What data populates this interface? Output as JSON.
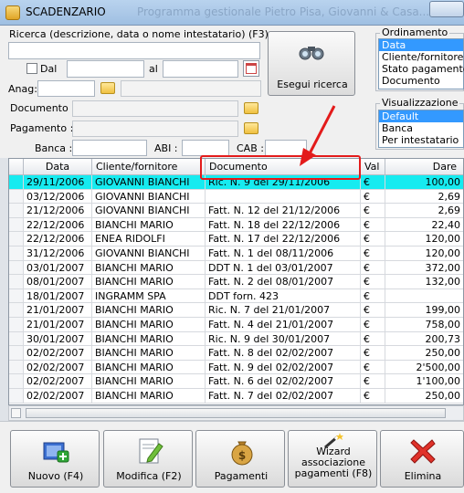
{
  "window": {
    "title": "SCADENZARIO",
    "background_title": "Programma gestionale Pietro Pisa, Giovanni & Casa..."
  },
  "search": {
    "label": "Ricerca (descrizione, data o nome intestatario) (F3)",
    "value": "",
    "dal_label": "Dal",
    "al_label": "al",
    "dal_value": "",
    "al_value": "",
    "anag_label": "Anag:",
    "documento_label": "Documento :",
    "pagamento_label": "Pagamento :",
    "banca_label": "Banca :",
    "abi_label": "ABI :",
    "cab_label": "CAB :",
    "search_button": "Esegui ricerca"
  },
  "ordinamento": {
    "title": "Ordinamento",
    "options": [
      "Data",
      "Cliente/fornitore",
      "Stato pagamento",
      "Documento"
    ],
    "selected": "Data"
  },
  "visualizzazione": {
    "title": "Visualizzazione",
    "options": [
      "Default",
      "Banca",
      "Per intestatario"
    ],
    "selected": "Default"
  },
  "table": {
    "columns": [
      "Data",
      "Cliente/fornitore",
      "Documento",
      "Val",
      "Dare"
    ],
    "rows": [
      [
        "29/11/2006",
        "GIOVANNI BIANCHI",
        "Ric. N. 9 del 29/11/2006",
        "€",
        "100,00"
      ],
      [
        "03/12/2006",
        "GIOVANNI BIANCHI",
        "",
        "€",
        "2,69"
      ],
      [
        "21/12/2006",
        "GIOVANNI BIANCHI",
        "Fatt. N. 12 del 21/12/2006",
        "€",
        "2,69"
      ],
      [
        "22/12/2006",
        "BIANCHI MARIO",
        "Fatt. N. 18 del 22/12/2006",
        "€",
        "22,40"
      ],
      [
        "22/12/2006",
        "ENEA RIDOLFI",
        "Fatt. N. 17 del 22/12/2006",
        "€",
        "120,00"
      ],
      [
        "31/12/2006",
        "GIOVANNI BIANCHI",
        "Fatt. N. 1 del 08/11/2006",
        "€",
        "120,00"
      ],
      [
        "03/01/2007",
        "BIANCHI MARIO",
        "DDT N. 1 del 03/01/2007",
        "€",
        "372,00"
      ],
      [
        "08/01/2007",
        "BIANCHI MARIO",
        "Fatt. N. 2 del 08/01/2007",
        "€",
        "132,00"
      ],
      [
        "18/01/2007",
        "INGRAMM SPA",
        "DDT forn. 423",
        "€",
        ""
      ],
      [
        "21/01/2007",
        "BIANCHI MARIO",
        "Ric. N. 7 del 21/01/2007",
        "€",
        "199,00"
      ],
      [
        "21/01/2007",
        "BIANCHI MARIO",
        "Fatt. N. 4 del 21/01/2007",
        "€",
        "758,00"
      ],
      [
        "30/01/2007",
        "BIANCHI MARIO",
        "Ric. N. 9 del 30/01/2007",
        "€",
        "200,73"
      ],
      [
        "02/02/2007",
        "BIANCHI MARIO",
        "Fatt. N. 8 del 02/02/2007",
        "€",
        "250,00"
      ],
      [
        "02/02/2007",
        "BIANCHI MARIO",
        "Fatt. N. 9 del 02/02/2007",
        "€",
        "2'500,00"
      ],
      [
        "02/02/2007",
        "BIANCHI MARIO",
        "Fatt. N. 6 del 02/02/2007",
        "€",
        "1'100,00"
      ],
      [
        "02/02/2007",
        "BIANCHI MARIO",
        "Fatt. N. 7 del 02/02/2007",
        "€",
        "250,00"
      ]
    ],
    "selected_row": 0
  },
  "toolbar": {
    "nuovo": "Nuovo (F4)",
    "modifica": "Modifica (F2)",
    "pagamenti": "Pagamenti",
    "wizard_line1": "Wizard",
    "wizard_line2": "associazione",
    "wizard_line3": "pagamenti (F8)",
    "elimina": "Elimina"
  },
  "colors": {
    "selected_row": "#16ebf0",
    "annotation": "#e31b1b",
    "list_selection": "#3399ff"
  }
}
